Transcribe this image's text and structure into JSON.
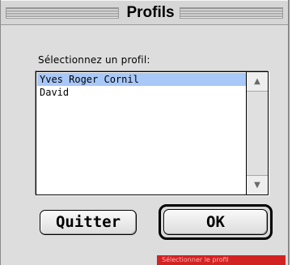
{
  "window": {
    "title": "Profils"
  },
  "dialog": {
    "prompt": "Sélectionnez un profil:",
    "profiles": [
      {
        "name": "Yves Roger Cornil",
        "selected": true
      },
      {
        "name": "David",
        "selected": false
      }
    ],
    "quit_label": "Quitter",
    "ok_label": "OK"
  },
  "status": {
    "text": "Sélectionner le profil"
  },
  "icons": {
    "scroll_up": "scroll-up-arrow-icon",
    "scroll_down": "scroll-down-arrow-icon"
  },
  "colors": {
    "selection": "#a8c8f8",
    "status_tag": "#d22323"
  }
}
